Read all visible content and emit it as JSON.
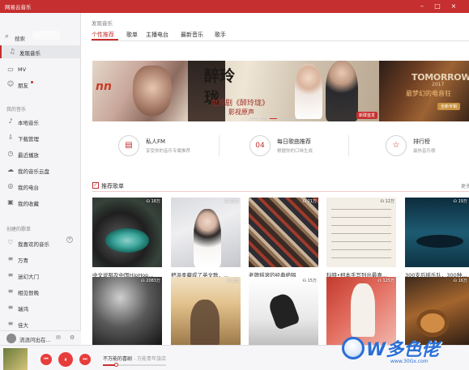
{
  "app": {
    "title": "网易云音乐"
  },
  "sidebar": {
    "search_label": "搜索",
    "discover": {
      "label": "发现音乐"
    },
    "top_items": [
      {
        "label": "MV"
      },
      {
        "label": "朋友"
      }
    ],
    "my_music_header": "我的音乐",
    "my_music": [
      {
        "label": "本地音乐"
      },
      {
        "label": "下载管理"
      },
      {
        "label": "最近播放"
      },
      {
        "label": "我的音乐云盘"
      },
      {
        "label": "我的电台"
      },
      {
        "label": "我的收藏"
      }
    ],
    "playlists_header": "创建的歌单",
    "playlists": [
      {
        "label": "我喜欢的音乐"
      },
      {
        "label": "万青"
      },
      {
        "label": "迷幻大门"
      },
      {
        "label": "相见恨晚"
      },
      {
        "label": "瑞鸿"
      },
      {
        "label": "佳大"
      }
    ],
    "user": {
      "name": "流浪问出在..."
    }
  },
  "main": {
    "title": "发现音乐",
    "tabs": [
      {
        "label": "个性推荐",
        "active": true
      },
      {
        "label": "歌单"
      },
      {
        "label": "主播电台"
      },
      {
        "label": "最新音乐"
      },
      {
        "label": "歌手"
      }
    ],
    "banners": {
      "left_text": "nn",
      "center": {
        "calligraphy": "醉玲珑",
        "line1": "电视剧《醉玲珑》",
        "line2": "影视原声",
        "tag": "新碟首发"
      },
      "right": {
        "title": "TOMORROW",
        "year": "2017",
        "subtitle": "最梦幻的电音狂",
        "button": "全新专辑"
      }
    },
    "features": [
      {
        "title": "私人FM",
        "desc": "享受你的音乐专属推荐",
        "icon": "radio-icon",
        "glyph": "▤"
      },
      {
        "title": "每日歌曲推荐",
        "desc": "根据你的口味生成",
        "icon": "calendar-icon",
        "glyph": "04"
      },
      {
        "title": "排行榜",
        "desc": "最热音乐榜",
        "icon": "star-icon",
        "glyph": "☆"
      }
    ],
    "recommended": {
      "title": "推荐歌单",
      "more": "更多",
      "playlists": [
        {
          "plays": "☊ 18万",
          "caption": "中文说唱及中国HipHop..."
        },
        {
          "plays": "☊ 21万",
          "caption": "把温柔藏成了英文歌，..."
        },
        {
          "plays": "☊ 21万",
          "caption": "老牌摇滚的经典绝唱"
        },
        {
          "plays": "☊ 12万",
          "caption": "科特•柯本手写列出最喜..."
        },
        {
          "plays": "☊ 19万",
          "caption": "300支后摇乐队，300种..."
        },
        {
          "plays": "☊ 2083万",
          "caption": ""
        },
        {
          "plays": "☊ 2万",
          "caption": ""
        },
        {
          "plays": "☊ 15万",
          "caption": ""
        },
        {
          "plays": "☊ 125万",
          "caption": ""
        },
        {
          "plays": "☊ 16万",
          "caption": ""
        }
      ]
    }
  },
  "player": {
    "track": "不万能的喜剧",
    "artist": "- 万能青年旅店",
    "progress": 0.2,
    "controls": {
      "prev": "⏮",
      "pause": "⏸",
      "next": "⏭"
    }
  },
  "watermark": {
    "text": "W多色佬",
    "url": "www.30Gx.com"
  },
  "colors": {
    "accent": "#c62f2f",
    "play_button": "#e83c3c"
  }
}
